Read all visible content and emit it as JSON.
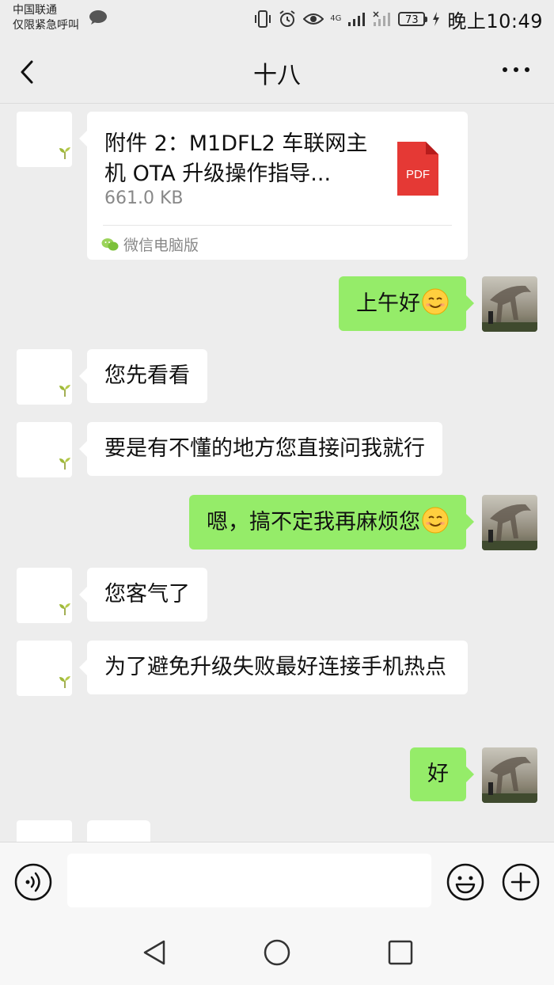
{
  "status_bar": {
    "carrier_line1": "中国联通",
    "carrier_line2": "仅限紧急呼叫",
    "battery_level": "73",
    "time": "晚上10:49",
    "network": "4G"
  },
  "header": {
    "title": "十八"
  },
  "file_message": {
    "file_name": "附件 2：M1DFL2 车联网主机 OTA 升级操作指导...",
    "file_size": "661.0 KB",
    "pdf_label": "PDF",
    "source": "微信电脑版"
  },
  "messages": [
    {
      "side": "right",
      "text": "上午好"
    },
    {
      "side": "left",
      "text": "您先看看"
    },
    {
      "side": "left",
      "text": "要是有不懂的地方您直接问我就行"
    },
    {
      "side": "right",
      "text": "嗯，搞不定我再麻烦您"
    },
    {
      "side": "left",
      "text": "您客气了"
    },
    {
      "side": "left",
      "text": "为了避免升级失败最好连接手机热点"
    },
    {
      "side": "right",
      "text": "好"
    }
  ],
  "input": {
    "value": "",
    "placeholder": ""
  },
  "colors": {
    "background": "#ededed",
    "sent_bubble": "#95ec69",
    "received_bubble": "#ffffff",
    "pdf_red": "#e53935"
  },
  "icons": [
    "back-icon",
    "more-icon",
    "voice-icon",
    "emoji-icon",
    "plus-icon",
    "pdf-icon",
    "wechat-icon",
    "nav-back-icon",
    "nav-home-icon",
    "nav-recent-icon"
  ]
}
